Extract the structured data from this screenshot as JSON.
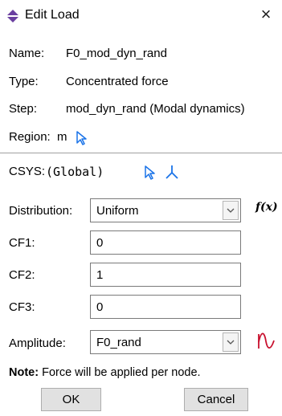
{
  "window": {
    "title": "Edit Load",
    "close_label": "×"
  },
  "info": {
    "name_label": "Name:",
    "name_value": "F0_mod_dyn_rand",
    "type_label": "Type:",
    "type_value": "Concentrated force",
    "step_label": "Step:",
    "step_value": "mod_dyn_rand (Modal dynamics)",
    "region_label": "Region:",
    "region_value": "m"
  },
  "csys": {
    "label": "CSYS:",
    "value": "(Global)"
  },
  "distribution": {
    "label": "Distribution:",
    "value": "Uniform",
    "fx_label": "f(x)"
  },
  "cf1": {
    "label": "CF1:",
    "value": "0"
  },
  "cf2": {
    "label": "CF2:",
    "value": "1"
  },
  "cf3": {
    "label": "CF3:",
    "value": "0"
  },
  "amplitude": {
    "label": "Amplitude:",
    "value": "F0_rand"
  },
  "note": {
    "bold": "Note:",
    "text": "Force will be applied per node."
  },
  "buttons": {
    "ok": "OK",
    "cancel": "Cancel"
  },
  "colors": {
    "accent_blue": "#1a73e8",
    "amp_red": "#c8102e",
    "title_icon": "#6a3fa0"
  }
}
